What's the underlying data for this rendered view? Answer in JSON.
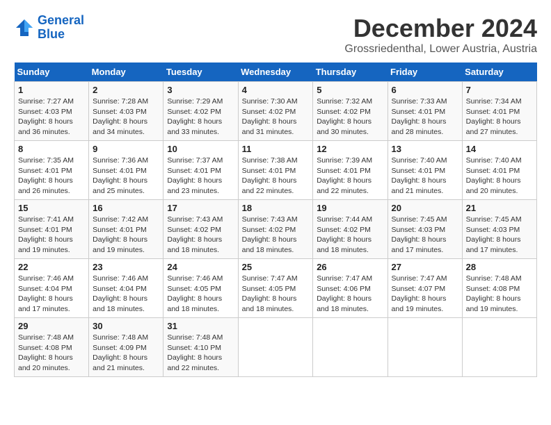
{
  "logo": {
    "line1": "General",
    "line2": "Blue"
  },
  "title": "December 2024",
  "location": "Grossriedenthal, Lower Austria, Austria",
  "weekdays": [
    "Sunday",
    "Monday",
    "Tuesday",
    "Wednesday",
    "Thursday",
    "Friday",
    "Saturday"
  ],
  "weeks": [
    [
      {
        "day": "1",
        "sunrise": "Sunrise: 7:27 AM",
        "sunset": "Sunset: 4:03 PM",
        "daylight": "Daylight: 8 hours and 36 minutes."
      },
      {
        "day": "2",
        "sunrise": "Sunrise: 7:28 AM",
        "sunset": "Sunset: 4:03 PM",
        "daylight": "Daylight: 8 hours and 34 minutes."
      },
      {
        "day": "3",
        "sunrise": "Sunrise: 7:29 AM",
        "sunset": "Sunset: 4:02 PM",
        "daylight": "Daylight: 8 hours and 33 minutes."
      },
      {
        "day": "4",
        "sunrise": "Sunrise: 7:30 AM",
        "sunset": "Sunset: 4:02 PM",
        "daylight": "Daylight: 8 hours and 31 minutes."
      },
      {
        "day": "5",
        "sunrise": "Sunrise: 7:32 AM",
        "sunset": "Sunset: 4:02 PM",
        "daylight": "Daylight: 8 hours and 30 minutes."
      },
      {
        "day": "6",
        "sunrise": "Sunrise: 7:33 AM",
        "sunset": "Sunset: 4:01 PM",
        "daylight": "Daylight: 8 hours and 28 minutes."
      },
      {
        "day": "7",
        "sunrise": "Sunrise: 7:34 AM",
        "sunset": "Sunset: 4:01 PM",
        "daylight": "Daylight: 8 hours and 27 minutes."
      }
    ],
    [
      {
        "day": "8",
        "sunrise": "Sunrise: 7:35 AM",
        "sunset": "Sunset: 4:01 PM",
        "daylight": "Daylight: 8 hours and 26 minutes."
      },
      {
        "day": "9",
        "sunrise": "Sunrise: 7:36 AM",
        "sunset": "Sunset: 4:01 PM",
        "daylight": "Daylight: 8 hours and 25 minutes."
      },
      {
        "day": "10",
        "sunrise": "Sunrise: 7:37 AM",
        "sunset": "Sunset: 4:01 PM",
        "daylight": "Daylight: 8 hours and 23 minutes."
      },
      {
        "day": "11",
        "sunrise": "Sunrise: 7:38 AM",
        "sunset": "Sunset: 4:01 PM",
        "daylight": "Daylight: 8 hours and 22 minutes."
      },
      {
        "day": "12",
        "sunrise": "Sunrise: 7:39 AM",
        "sunset": "Sunset: 4:01 PM",
        "daylight": "Daylight: 8 hours and 22 minutes."
      },
      {
        "day": "13",
        "sunrise": "Sunrise: 7:40 AM",
        "sunset": "Sunset: 4:01 PM",
        "daylight": "Daylight: 8 hours and 21 minutes."
      },
      {
        "day": "14",
        "sunrise": "Sunrise: 7:40 AM",
        "sunset": "Sunset: 4:01 PM",
        "daylight": "Daylight: 8 hours and 20 minutes."
      }
    ],
    [
      {
        "day": "15",
        "sunrise": "Sunrise: 7:41 AM",
        "sunset": "Sunset: 4:01 PM",
        "daylight": "Daylight: 8 hours and 19 minutes."
      },
      {
        "day": "16",
        "sunrise": "Sunrise: 7:42 AM",
        "sunset": "Sunset: 4:01 PM",
        "daylight": "Daylight: 8 hours and 19 minutes."
      },
      {
        "day": "17",
        "sunrise": "Sunrise: 7:43 AM",
        "sunset": "Sunset: 4:02 PM",
        "daylight": "Daylight: 8 hours and 18 minutes."
      },
      {
        "day": "18",
        "sunrise": "Sunrise: 7:43 AM",
        "sunset": "Sunset: 4:02 PM",
        "daylight": "Daylight: 8 hours and 18 minutes."
      },
      {
        "day": "19",
        "sunrise": "Sunrise: 7:44 AM",
        "sunset": "Sunset: 4:02 PM",
        "daylight": "Daylight: 8 hours and 18 minutes."
      },
      {
        "day": "20",
        "sunrise": "Sunrise: 7:45 AM",
        "sunset": "Sunset: 4:03 PM",
        "daylight": "Daylight: 8 hours and 17 minutes."
      },
      {
        "day": "21",
        "sunrise": "Sunrise: 7:45 AM",
        "sunset": "Sunset: 4:03 PM",
        "daylight": "Daylight: 8 hours and 17 minutes."
      }
    ],
    [
      {
        "day": "22",
        "sunrise": "Sunrise: 7:46 AM",
        "sunset": "Sunset: 4:04 PM",
        "daylight": "Daylight: 8 hours and 17 minutes."
      },
      {
        "day": "23",
        "sunrise": "Sunrise: 7:46 AM",
        "sunset": "Sunset: 4:04 PM",
        "daylight": "Daylight: 8 hours and 18 minutes."
      },
      {
        "day": "24",
        "sunrise": "Sunrise: 7:46 AM",
        "sunset": "Sunset: 4:05 PM",
        "daylight": "Daylight: 8 hours and 18 minutes."
      },
      {
        "day": "25",
        "sunrise": "Sunrise: 7:47 AM",
        "sunset": "Sunset: 4:05 PM",
        "daylight": "Daylight: 8 hours and 18 minutes."
      },
      {
        "day": "26",
        "sunrise": "Sunrise: 7:47 AM",
        "sunset": "Sunset: 4:06 PM",
        "daylight": "Daylight: 8 hours and 18 minutes."
      },
      {
        "day": "27",
        "sunrise": "Sunrise: 7:47 AM",
        "sunset": "Sunset: 4:07 PM",
        "daylight": "Daylight: 8 hours and 19 minutes."
      },
      {
        "day": "28",
        "sunrise": "Sunrise: 7:48 AM",
        "sunset": "Sunset: 4:08 PM",
        "daylight": "Daylight: 8 hours and 19 minutes."
      }
    ],
    [
      {
        "day": "29",
        "sunrise": "Sunrise: 7:48 AM",
        "sunset": "Sunset: 4:08 PM",
        "daylight": "Daylight: 8 hours and 20 minutes."
      },
      {
        "day": "30",
        "sunrise": "Sunrise: 7:48 AM",
        "sunset": "Sunset: 4:09 PM",
        "daylight": "Daylight: 8 hours and 21 minutes."
      },
      {
        "day": "31",
        "sunrise": "Sunrise: 7:48 AM",
        "sunset": "Sunset: 4:10 PM",
        "daylight": "Daylight: 8 hours and 22 minutes."
      },
      null,
      null,
      null,
      null
    ]
  ]
}
